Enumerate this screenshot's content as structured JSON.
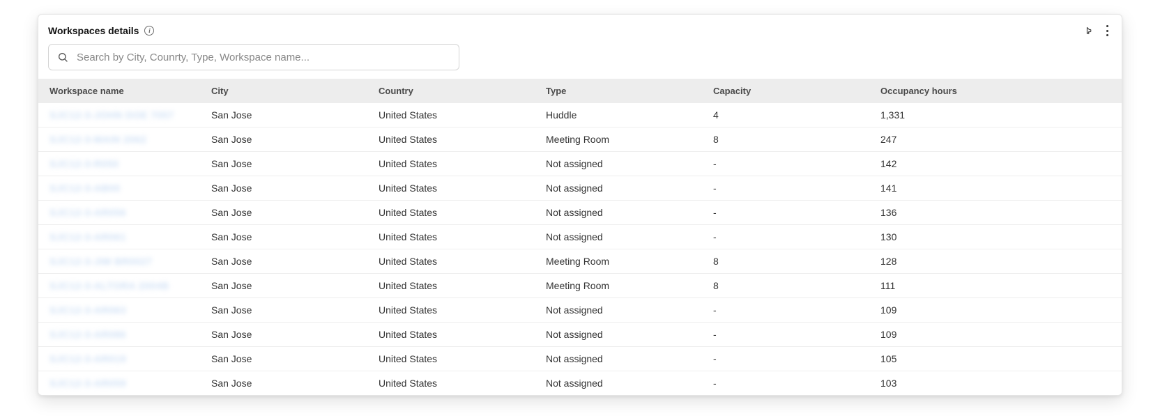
{
  "panel": {
    "title": "Workspaces details"
  },
  "search": {
    "placeholder": "Search by City, Counrty, Type, Workspace name..."
  },
  "table": {
    "headers": {
      "name": "Workspace name",
      "city": "City",
      "country": "Country",
      "type": "Type",
      "capacity": "Capacity",
      "occupancy": "Occupancy hours"
    },
    "rows": [
      {
        "name": "SJC12-3-JOHN DOE 7057",
        "city": "San Jose",
        "country": "United States",
        "type": "Huddle",
        "capacity": "4",
        "occupancy": "1,331"
      },
      {
        "name": "SJC12-3-MAIN 2062",
        "city": "San Jose",
        "country": "United States",
        "type": "Meeting Room",
        "capacity": "8",
        "occupancy": "247"
      },
      {
        "name": "SJC12-3-R050",
        "city": "San Jose",
        "country": "United States",
        "type": "Not assigned",
        "capacity": "-",
        "occupancy": "142"
      },
      {
        "name": "SJC12-3-AB00",
        "city": "San Jose",
        "country": "United States",
        "type": "Not assigned",
        "capacity": "-",
        "occupancy": "141"
      },
      {
        "name": "SJC12-3-AR056",
        "city": "San Jose",
        "country": "United States",
        "type": "Not assigned",
        "capacity": "-",
        "occupancy": "136"
      },
      {
        "name": "SJC12-3-AR061",
        "city": "San Jose",
        "country": "United States",
        "type": "Not assigned",
        "capacity": "-",
        "occupancy": "130"
      },
      {
        "name": "SJC12-3-JIM BR0027",
        "city": "San Jose",
        "country": "United States",
        "type": "Meeting Room",
        "capacity": "8",
        "occupancy": "128"
      },
      {
        "name": "SJC12-3-ALTORA 2004B",
        "city": "San Jose",
        "country": "United States",
        "type": "Meeting Room",
        "capacity": "8",
        "occupancy": "111"
      },
      {
        "name": "SJC12-3-AR063",
        "city": "San Jose",
        "country": "United States",
        "type": "Not assigned",
        "capacity": "-",
        "occupancy": "109"
      },
      {
        "name": "SJC12-3-AR086",
        "city": "San Jose",
        "country": "United States",
        "type": "Not assigned",
        "capacity": "-",
        "occupancy": "109"
      },
      {
        "name": "SJC12-3-AR019",
        "city": "San Jose",
        "country": "United States",
        "type": "Not assigned",
        "capacity": "-",
        "occupancy": "105"
      },
      {
        "name": "SJC12-3-AR059",
        "city": "San Jose",
        "country": "United States",
        "type": "Not assigned",
        "capacity": "-",
        "occupancy": "103"
      }
    ]
  }
}
